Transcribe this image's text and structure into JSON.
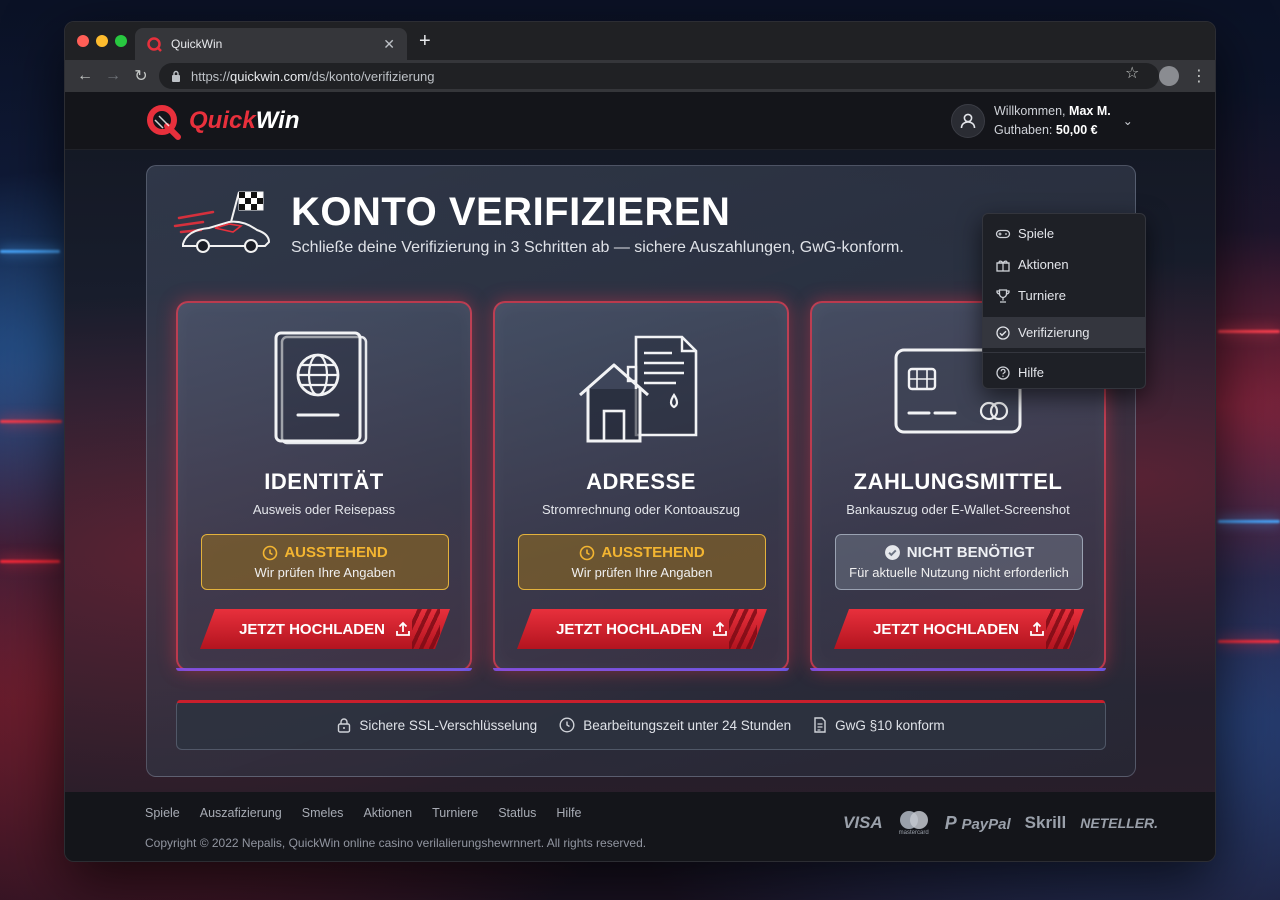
{
  "browser": {
    "tab_title": "QuickWin",
    "url_prefix": "https://",
    "url_domain": "quickwin.com",
    "url_path": "/ds/konto/verifizierung"
  },
  "header": {
    "logo_text_a": "Quick",
    "logo_text_b": "Win",
    "welcome_label": "Willkommen,",
    "user_name": "Max M.",
    "balance_label": "Guthaben:",
    "balance_value": "50,00 €"
  },
  "menu": {
    "items": [
      {
        "label": "Spiele",
        "icon": "gamepad-icon"
      },
      {
        "label": "Aktionen",
        "icon": "gift-icon"
      },
      {
        "label": "Turniere",
        "icon": "trophy-icon"
      },
      {
        "label": "Verifizierung",
        "icon": "check-circle-icon",
        "active": true
      },
      {
        "label": "Hilfe",
        "icon": "question-icon"
      }
    ]
  },
  "page": {
    "title": "KONTO VERIFIZIEREN",
    "subtitle": "Schließe deine Verifizierung in 3 Schritten ab — sichere Auszahlungen, GwG-konform."
  },
  "cards": [
    {
      "title": "IDENTITÄT",
      "subtitle": "Ausweis oder Reisepass",
      "status": "AUSSTEHEND",
      "status_sub": "Wir prüfen Ihre Angaben",
      "status_type": "pending",
      "button": "JETZT HOCHLADEN",
      "icon": "passport-icon"
    },
    {
      "title": "ADRESSE",
      "subtitle": "Stromrechnung oder Kontoauszug",
      "status": "AUSSTEHEND",
      "status_sub": "Wir prüfen Ihre Angaben",
      "status_type": "pending",
      "button": "JETZT HOCHLADEN",
      "icon": "house-document-icon"
    },
    {
      "title": "ZAHLUNGSMITTEL",
      "subtitle": "Bankauszug oder E-Wallet-Screenshot",
      "status": "NICHT BENÖTIGT",
      "status_sub": "Für aktuelle Nutzung nicht erforderlich",
      "status_type": "neutral",
      "button": "JETZT HOCHLADEN",
      "icon": "credit-card-icon"
    }
  ],
  "info": {
    "ssl": "Sichere SSL-Verschlüsselung",
    "time": "Bearbeitungszeit unter 24 Stunden",
    "gwg": "GwG §10 konform"
  },
  "footer": {
    "links": [
      "Spiele",
      "Auszafizierung",
      "Smeles",
      "Aktionen",
      "Turniere",
      "Statlus",
      "Hilfe"
    ],
    "copyright": "Copyright © 2022 Nepalis, QuickWin online casino verilalierungshewrnnert. All rights reserved.",
    "payments": [
      "VISA",
      "mastercard",
      "PayPal",
      "Skrill",
      "NETELLER."
    ]
  },
  "colors": {
    "accent_red": "#e8303c",
    "pending_amber": "#f3b531"
  }
}
